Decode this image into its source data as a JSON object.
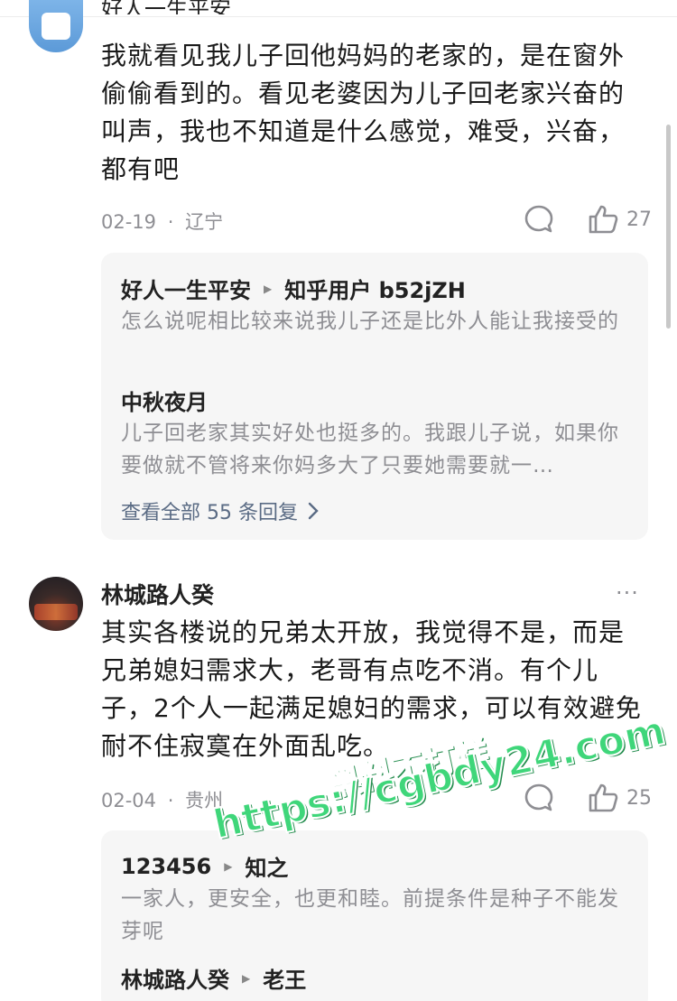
{
  "comment1": {
    "author_clipped": "好人一生平安",
    "text": "我就看见我儿子回他妈妈的老家的，是在窗外偷偷看到的。看见老婆因为儿子回老家兴奋的叫声，我也不知道是什么感觉，难受，兴奋，都有吧",
    "date": "02-19",
    "location": "辽宁",
    "likes": "27",
    "replies": [
      {
        "author": "好人一生平安",
        "reply_to": "知乎用户 b52jZH",
        "text": "怎么说呢相比较来说我儿子还是比外人能让我接受的"
      },
      {
        "author": "中秋夜月",
        "reply_to": "",
        "text": "儿子回老家其实好处也挺多的。我跟儿子说，如果你要做就不管将来你妈多大了只要她需要就一…"
      }
    ],
    "view_all": "查看全部 55 条回复"
  },
  "comment2": {
    "author": "林城路人癸",
    "text": "其实各楼说的兄弟太开放，我觉得不是，而是兄弟媳妇需求大，老哥有点吃不消。有个儿子，2个人一起满足媳妇的需求，可以有效避免耐不住寂寞在外面乱吃。",
    "date": "02-04",
    "location": "贵州",
    "likes": "25",
    "more": "···",
    "replies": [
      {
        "author": "123456",
        "reply_to": "知之",
        "text": "一家人，更安全，也更和睦。前提条件是种子不能发芽呢"
      },
      {
        "author": "林城路人癸",
        "reply_to": "老王",
        "text": ""
      }
    ]
  },
  "watermark": {
    "line1": "黑料不打烊",
    "line2": "https://cgbdy24.com"
  },
  "icons": [
    "comment-icon",
    "like-icon",
    "chevron-right-icon",
    "more-icon",
    "triangle-arrow-icon"
  ],
  "colors": {
    "meta": "#8e8e93",
    "link": "#5a6b84",
    "reply_bg": "#f6f6f6",
    "watermark": "#3fd67a"
  }
}
